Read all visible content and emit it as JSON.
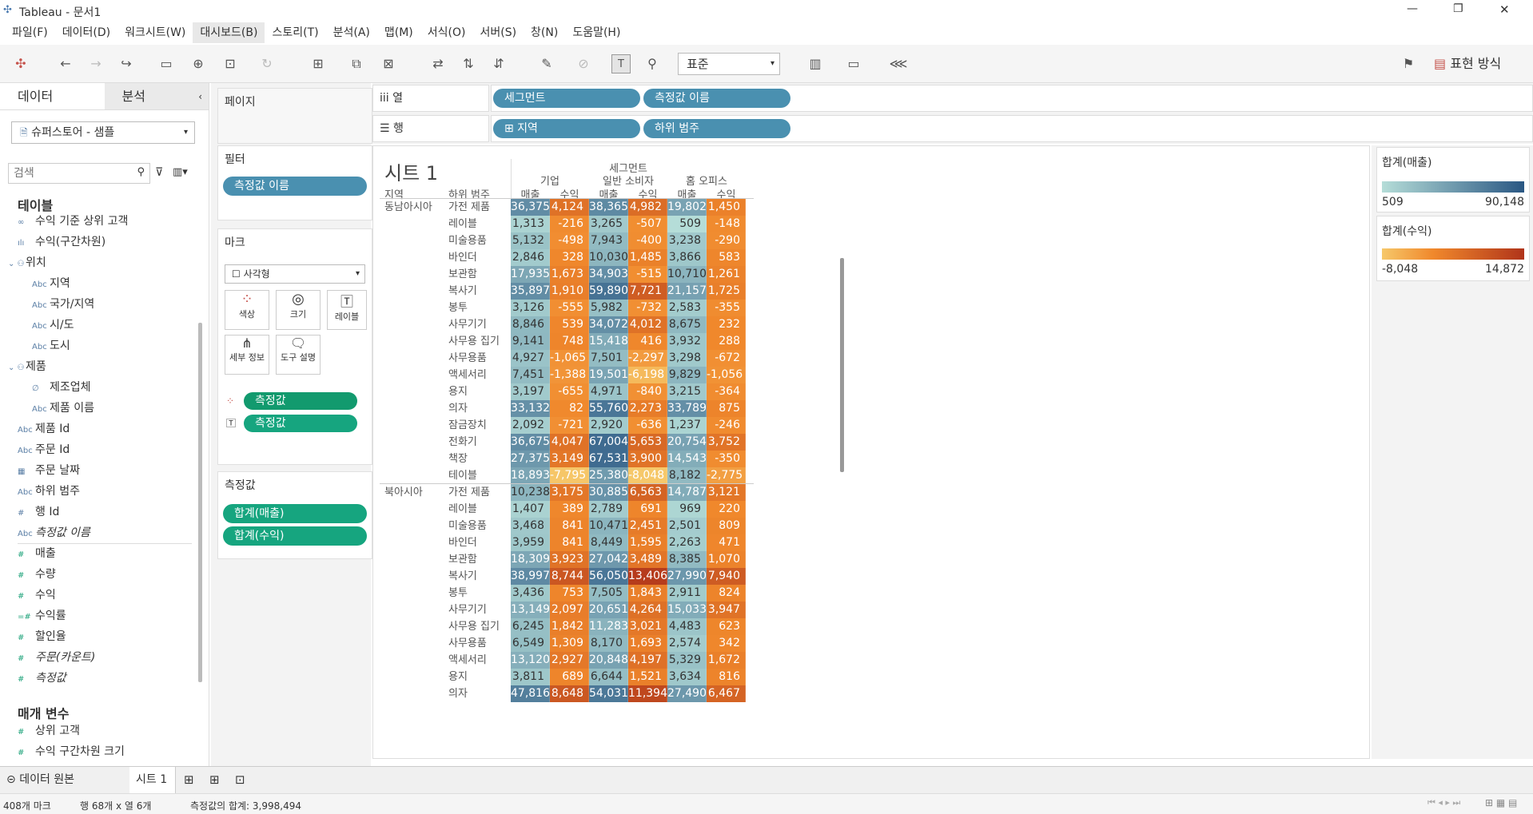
{
  "window": {
    "title": "Tableau - 문서1",
    "controls": [
      "—",
      "❐",
      "✕"
    ]
  },
  "menu": [
    "파일(F)",
    "데이터(D)",
    "워크시트(W)",
    "대시보드(B)",
    "스토리(T)",
    "분석(A)",
    "맵(M)",
    "서식(O)",
    "서버(S)",
    "창(N)",
    "도움말(H)"
  ],
  "toolbar": {
    "fit_select": "표준",
    "show_me": "표현 방식"
  },
  "left": {
    "tab_data": "데이터",
    "tab_analysis": "분석",
    "datasource": "슈퍼스토어 - 샘플",
    "search_placeholder": "검색",
    "tables_title": "테이블",
    "params_title": "매개 변수",
    "fields": [
      {
        "icon": "∞",
        "label": "수익 기준 상위 고객",
        "m": false
      },
      {
        "icon": "ılı",
        "label": "수익(구간차원)",
        "m": false
      },
      {
        "icon": "⌄ ⚇",
        "label": "위치",
        "m": false
      },
      {
        "icon": "Abc",
        "label": "지역",
        "m": false
      },
      {
        "icon": "Abc",
        "label": "국가/지역",
        "m": false
      },
      {
        "icon": "Abc",
        "label": "시/도",
        "m": false
      },
      {
        "icon": "Abc",
        "label": "도시",
        "m": false
      },
      {
        "icon": "⌄ ⚇",
        "label": "제품",
        "m": false
      },
      {
        "icon": "∅",
        "label": "제조업체",
        "m": false
      },
      {
        "icon": "Abc",
        "label": "제품 이름",
        "m": false
      },
      {
        "icon": "Abc",
        "label": "제품 Id",
        "m": false
      },
      {
        "icon": "Abc",
        "label": "주문 Id",
        "m": false
      },
      {
        "icon": "▦",
        "label": "주문 날짜",
        "m": false
      },
      {
        "icon": "Abc",
        "label": "하위 범주",
        "m": false
      },
      {
        "icon": "#",
        "label": "행 Id",
        "m": false
      },
      {
        "icon": "Abc",
        "label": "측정값 이름",
        "m": false
      },
      {
        "icon": "#",
        "label": "매출",
        "m": true
      },
      {
        "icon": "#",
        "label": "수량",
        "m": true
      },
      {
        "icon": "#",
        "label": "수익",
        "m": true
      },
      {
        "icon": "=#",
        "label": "수익률",
        "m": true
      },
      {
        "icon": "#",
        "label": "할인율",
        "m": true
      },
      {
        "icon": "#",
        "label": "주문(카운트)",
        "m": true
      },
      {
        "icon": "#",
        "label": "측정값",
        "m": true
      }
    ],
    "params": [
      "상위 고객",
      "수익 구간차원 크기"
    ]
  },
  "shelves": {
    "pages": "페이지",
    "filters": "필터",
    "filter_pill": "측정값 이름",
    "marks": "마크",
    "mark_type": "사각형",
    "mark_buttons": [
      "색상",
      "크기",
      "레이블",
      "세부 정보",
      "도구 설명"
    ],
    "mark_pill1": "측정값",
    "mark_pill2": "측정값",
    "measures": "측정값",
    "measure_pills": [
      "합계(매출)",
      "합계(수익)"
    ],
    "columns_label": "iii 열",
    "rows_label": "☰ 행",
    "col_pills": [
      "세그먼트",
      "측정값 이름"
    ],
    "row_pills": [
      "⊞ 지역",
      "하위 범주"
    ]
  },
  "sheet": {
    "title": "시트 1",
    "top_header": "세그먼트",
    "segments": [
      "기업",
      "일반 소비자",
      "홈 오피스"
    ],
    "measures": [
      "매출",
      "수익"
    ],
    "row_header1": "지역",
    "row_header2": "하위 범주"
  },
  "legends": {
    "sales_title": "합계(매출)",
    "sales_min": "509",
    "sales_max": "90,148",
    "profit_title": "합계(수익)",
    "profit_min": "-8,048",
    "profit_max": "14,872",
    "colors": {
      "sales_low": "#b5ddd8",
      "sales_high": "#2a5783",
      "profit_low": "#f6c86a",
      "profit_high": "#b0341a"
    }
  },
  "chart_data": {
    "type": "table",
    "regions": [
      {
        "name": "동남아시아",
        "rows": [
          [
            "가전 제품",
            36375,
            4124,
            38365,
            4982,
            19802,
            1450
          ],
          [
            "레이블",
            1313,
            -216,
            3265,
            -507,
            509,
            -148
          ],
          [
            "미술용품",
            5132,
            -498,
            7943,
            -400,
            3238,
            -290
          ],
          [
            "바인더",
            2846,
            328,
            10030,
            1485,
            3866,
            583
          ],
          [
            "보관함",
            17935,
            1673,
            34903,
            -515,
            10710,
            1261
          ],
          [
            "복사기",
            35897,
            1910,
            59890,
            7721,
            21157,
            1725
          ],
          [
            "봉투",
            3126,
            -555,
            5982,
            -732,
            2583,
            -355
          ],
          [
            "사무기기",
            8846,
            539,
            34072,
            4012,
            8675,
            232
          ],
          [
            "사무용 집기",
            9141,
            748,
            15418,
            416,
            3932,
            288
          ],
          [
            "사무용품",
            4927,
            -1065,
            7501,
            -2297,
            3298,
            -672
          ],
          [
            "액세서리",
            7451,
            -1388,
            19501,
            -6198,
            9829,
            -1056
          ],
          [
            "용지",
            3197,
            -655,
            4971,
            -840,
            3215,
            -364
          ],
          [
            "의자",
            33132,
            82,
            55760,
            2273,
            33789,
            875
          ],
          [
            "잠금장치",
            2092,
            -721,
            2920,
            -636,
            1237,
            -246
          ],
          [
            "전화기",
            36675,
            4047,
            67004,
            5653,
            20754,
            3752
          ],
          [
            "책장",
            27375,
            3149,
            67531,
            3900,
            14543,
            -350
          ],
          [
            "테이블",
            18893,
            -7795,
            25380,
            -8048,
            8182,
            -2775
          ]
        ]
      },
      {
        "name": "북아시아",
        "rows": [
          [
            "가전 제품",
            10238,
            3175,
            30885,
            6563,
            14787,
            3121
          ],
          [
            "레이블",
            1407,
            389,
            2789,
            691,
            969,
            220
          ],
          [
            "미술용품",
            3468,
            841,
            10471,
            2451,
            2501,
            809
          ],
          [
            "바인더",
            3959,
            841,
            8449,
            1595,
            2263,
            471
          ],
          [
            "보관함",
            18309,
            3923,
            27042,
            3489,
            8385,
            1070
          ],
          [
            "복사기",
            38997,
            8744,
            56050,
            13406,
            27990,
            7940
          ],
          [
            "봉투",
            3436,
            753,
            7505,
            1843,
            2911,
            824
          ],
          [
            "사무기기",
            13149,
            2097,
            20651,
            4264,
            15033,
            3947
          ],
          [
            "사무용 집기",
            6245,
            1842,
            11283,
            3021,
            4483,
            623
          ],
          [
            "사무용품",
            6549,
            1309,
            8170,
            1693,
            2574,
            342
          ],
          [
            "액세서리",
            13120,
            2927,
            20848,
            4197,
            5329,
            1672
          ],
          [
            "용지",
            3811,
            689,
            6644,
            1521,
            3634,
            816
          ],
          [
            "의자",
            47816,
            8648,
            54031,
            11394,
            27490,
            6467
          ]
        ]
      }
    ]
  },
  "bottom": {
    "datasource_tab": "데이터 원본",
    "sheet_tab": "시트 1"
  },
  "status": {
    "marks": "408개 마크",
    "dims": "행 68개  x  열 6개",
    "sum": "측정값의 합계: 3,998,494"
  }
}
